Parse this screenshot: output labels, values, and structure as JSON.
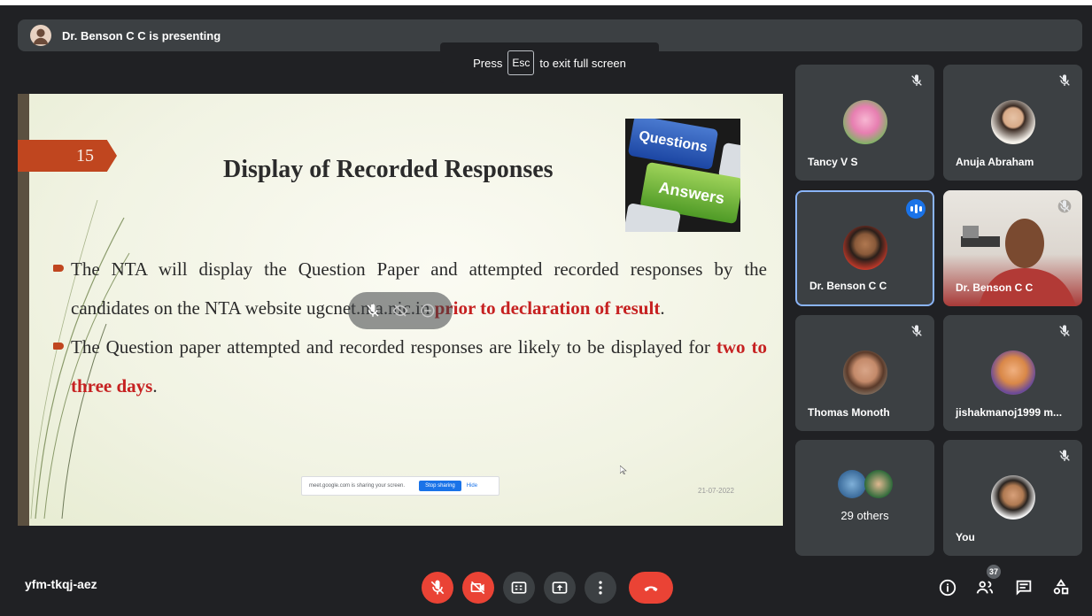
{
  "presenter_banner": {
    "text": "Dr. Benson C C is presenting"
  },
  "fullscreen_toast": {
    "prefix": "Press",
    "key": "Esc",
    "suffix": "to exit full screen"
  },
  "slide": {
    "number": "15",
    "title": "Display of Recorded Responses",
    "image": {
      "key1": "Questions",
      "key2": "Answers"
    },
    "bullets": [
      {
        "text1": "The NTA will display the Question Paper and attempted recorded responses by the candidates on the NTA website ugcnet.nta.nic.in ",
        "highlight": "prior to declaration of result",
        "text2": "."
      },
      {
        "text1": "The Question paper attempted and recorded responses are likely to be displayed for ",
        "highlight": "two to three days",
        "text2": "."
      }
    ],
    "date": "21-07-2022"
  },
  "share_notice": {
    "text": "meet.google.com is sharing your screen.",
    "stop": "Stop sharing",
    "hide": "Hide"
  },
  "participants": [
    {
      "name": "Tancy V S",
      "muted": true,
      "avatar": "flower-avatar"
    },
    {
      "name": "Anuja Abraham",
      "muted": true,
      "avatar": "woman-avatar"
    },
    {
      "name": "Dr. Benson C C",
      "muted": false,
      "speaking": true,
      "avatar": "man-avatar"
    },
    {
      "name": "Dr. Benson C C",
      "muted": true,
      "video": true
    },
    {
      "name": "Thomas Monoth",
      "muted": true,
      "avatar": "man-avatar"
    },
    {
      "name": "jishakmanoj1999 m...",
      "muted": true,
      "avatar": "person-avatar"
    },
    {
      "others": "29 others"
    },
    {
      "name": "You",
      "muted": true,
      "avatar": "man-avatar"
    }
  ],
  "meeting_code": "yfm-tkqj-aez",
  "controls": [
    "mic-off-icon",
    "camera-off-icon",
    "captions-icon",
    "present-icon",
    "more-icon",
    "end-call-icon"
  ],
  "right_controls": [
    "info-icon",
    "people-icon",
    "chat-icon",
    "activities-icon"
  ],
  "participant_count": "37",
  "colors": {
    "bg": "#202124",
    "tile": "#3c4043",
    "red": "#ea4335",
    "accent": "#8ab4f8"
  }
}
